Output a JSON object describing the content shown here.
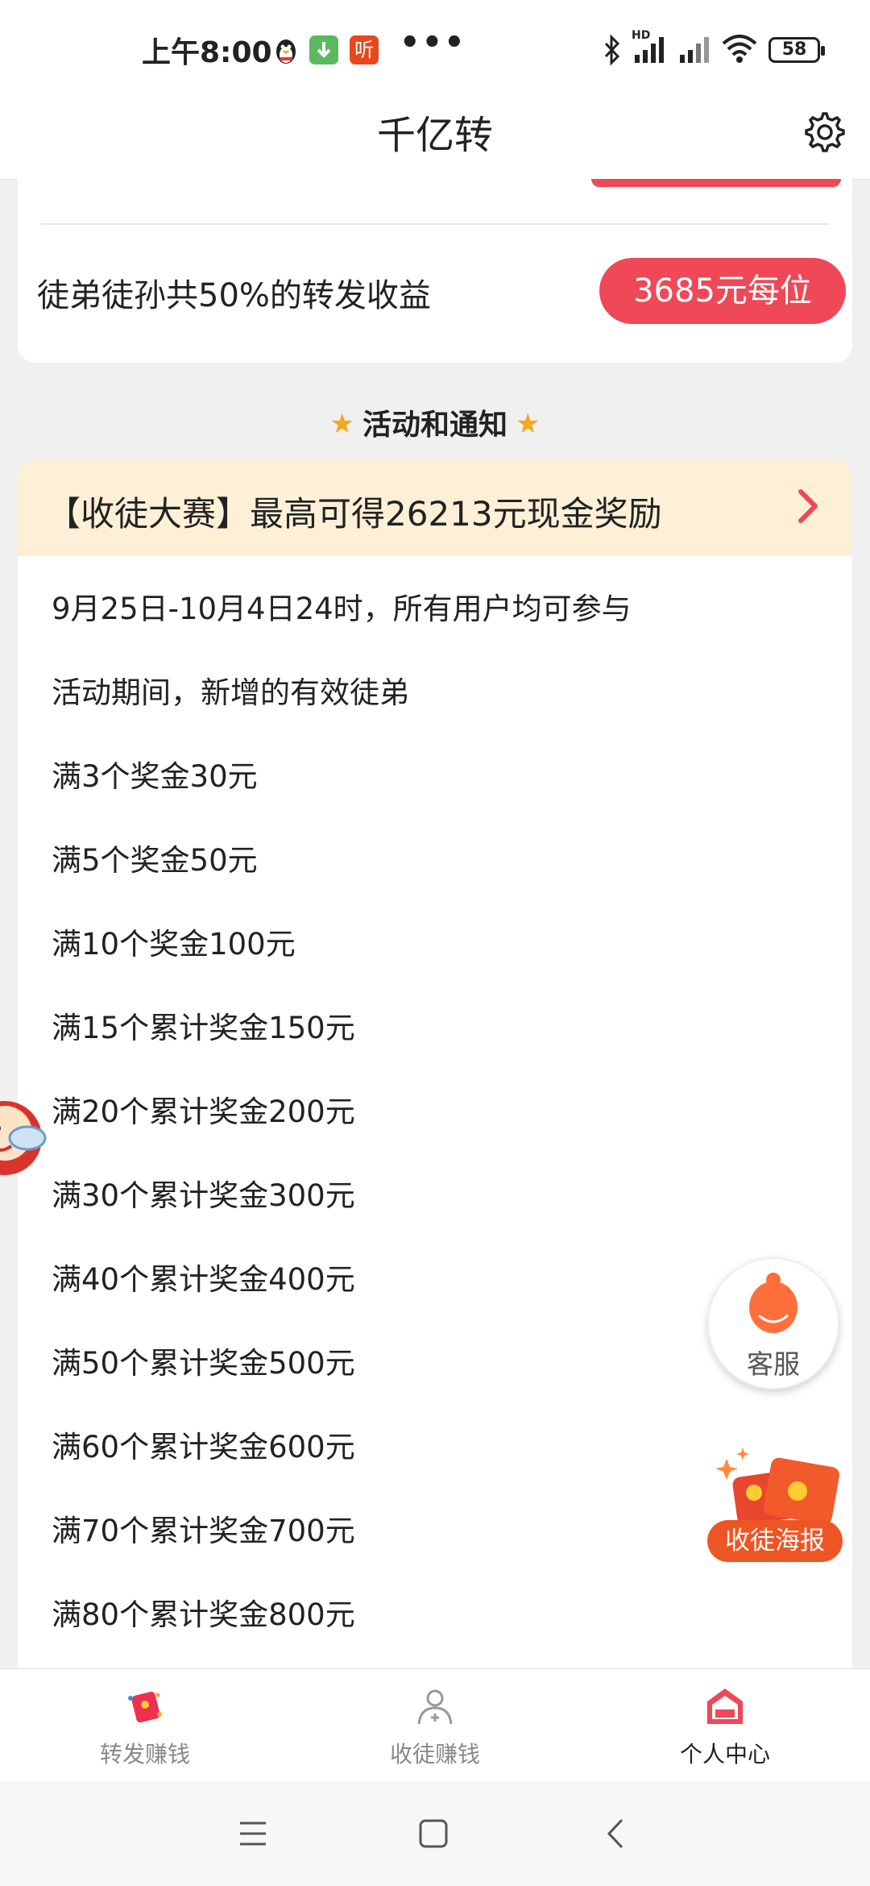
{
  "status_bar": {
    "time": "上午8:00",
    "ting_badge": "听",
    "overflow": "•••",
    "hd": "HD",
    "battery": "58"
  },
  "header": {
    "title": "千亿转"
  },
  "earnings": {
    "label": "徒弟徒孙共50%的转发收益",
    "amount": "3685元每位"
  },
  "section": {
    "star": "★",
    "title": "活动和通知"
  },
  "activity": {
    "title": "【收徒大赛】最高可得26213元现金奖励",
    "lines": [
      "9月25日-10月4日24时，所有用户均可参与",
      "活动期间，新增的有效徒弟",
      "满3个奖金30元",
      "满5个奖金50元",
      "满10个奖金100元",
      "满15个累计奖金150元",
      "满20个累计奖金200元",
      "满30个累计奖金300元",
      "满40个累计奖金400元",
      "满50个累计奖金500元",
      "满60个累计奖金600元",
      "满70个累计奖金700元",
      "满80个累计奖金800元"
    ]
  },
  "floating": {
    "service_label": "客服",
    "poster_label": "收徒海报"
  },
  "tabbar": {
    "tabs": [
      {
        "label": "转发赚钱",
        "icon": "red-envelope-icon"
      },
      {
        "label": "收徒赚钱",
        "icon": "add-person-icon"
      },
      {
        "label": "个人中心",
        "icon": "home-icon",
        "active": true
      }
    ]
  },
  "colors": {
    "accent": "#ef4857",
    "banner_bg": "#fdf0d6",
    "page_bg": "#f0f0f0",
    "poster_orange": "#ee5524"
  }
}
